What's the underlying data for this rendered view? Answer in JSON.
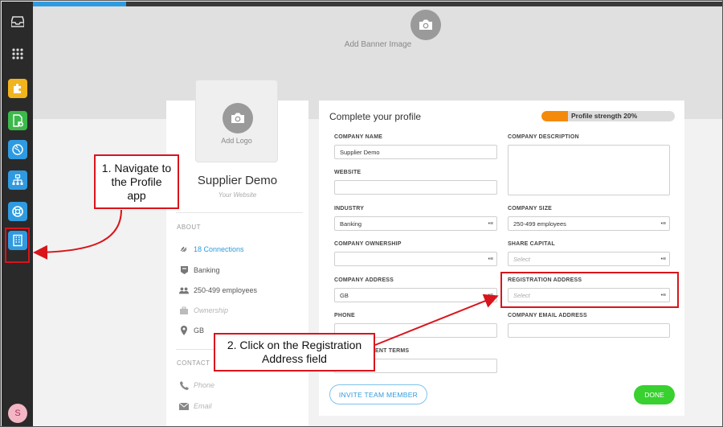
{
  "sidenav": {
    "apps": [
      {
        "icon": "puzzle-icon",
        "color": "#f2b41c"
      },
      {
        "icon": "document-add-icon",
        "color": "#3cb94a"
      },
      {
        "icon": "globe-icon",
        "color": "#2f9ae0"
      },
      {
        "icon": "org-chart-icon",
        "color": "#2f9ae0"
      },
      {
        "icon": "lifebuoy-icon",
        "color": "#2f9ae0"
      },
      {
        "icon": "building-icon",
        "color": "#2f9ae0"
      }
    ],
    "avatar_initial": "S"
  },
  "banner": {
    "label": "Add Banner Image"
  },
  "profile": {
    "logo_label": "Add Logo",
    "company_name": "Supplier Demo",
    "website_placeholder": "Your Website",
    "about_heading": "ABOUT",
    "connections": "18 Connections",
    "industry": "Banking",
    "size": "250-499 employees",
    "ownership_placeholder": "Ownership",
    "country": "GB",
    "contact_heading": "CONTACT",
    "phone_placeholder": "Phone",
    "email_placeholder": "Email"
  },
  "form": {
    "title": "Complete your profile",
    "strength_label": "Profile strength 20%",
    "strength_percent": 20,
    "fields": {
      "company_name": {
        "label": "COMPANY NAME",
        "value": "Supplier Demo"
      },
      "company_description": {
        "label": "COMPANY DESCRIPTION",
        "value": ""
      },
      "website": {
        "label": "WEBSITE",
        "value": ""
      },
      "industry": {
        "label": "INDUSTRY",
        "value": "Banking"
      },
      "company_size": {
        "label": "COMPANY SIZE",
        "value": "250-499 employees"
      },
      "company_ownership": {
        "label": "COMPANY OWNERSHIP",
        "value": ""
      },
      "share_capital": {
        "label": "SHARE CAPITAL",
        "placeholder": "Select"
      },
      "company_address": {
        "label": "COMPANY ADDRESS",
        "value": "GB"
      },
      "registration_address": {
        "label": "REGISTRATION ADDRESS",
        "placeholder": "Select"
      },
      "phone": {
        "label": "PHONE",
        "value": ""
      },
      "company_email": {
        "label": "COMPANY EMAIL ADDRESS",
        "value": ""
      },
      "payment_terms": {
        "label": "ENT TERMS",
        "value": ""
      }
    },
    "invite_label": "INVITE TEAM MEMBER",
    "done_label": "DONE"
  },
  "annotations": {
    "step1": "1. Navigate to the Profile app",
    "step2": "2. Click on the Registration Address field",
    "color": "#d9141b"
  }
}
